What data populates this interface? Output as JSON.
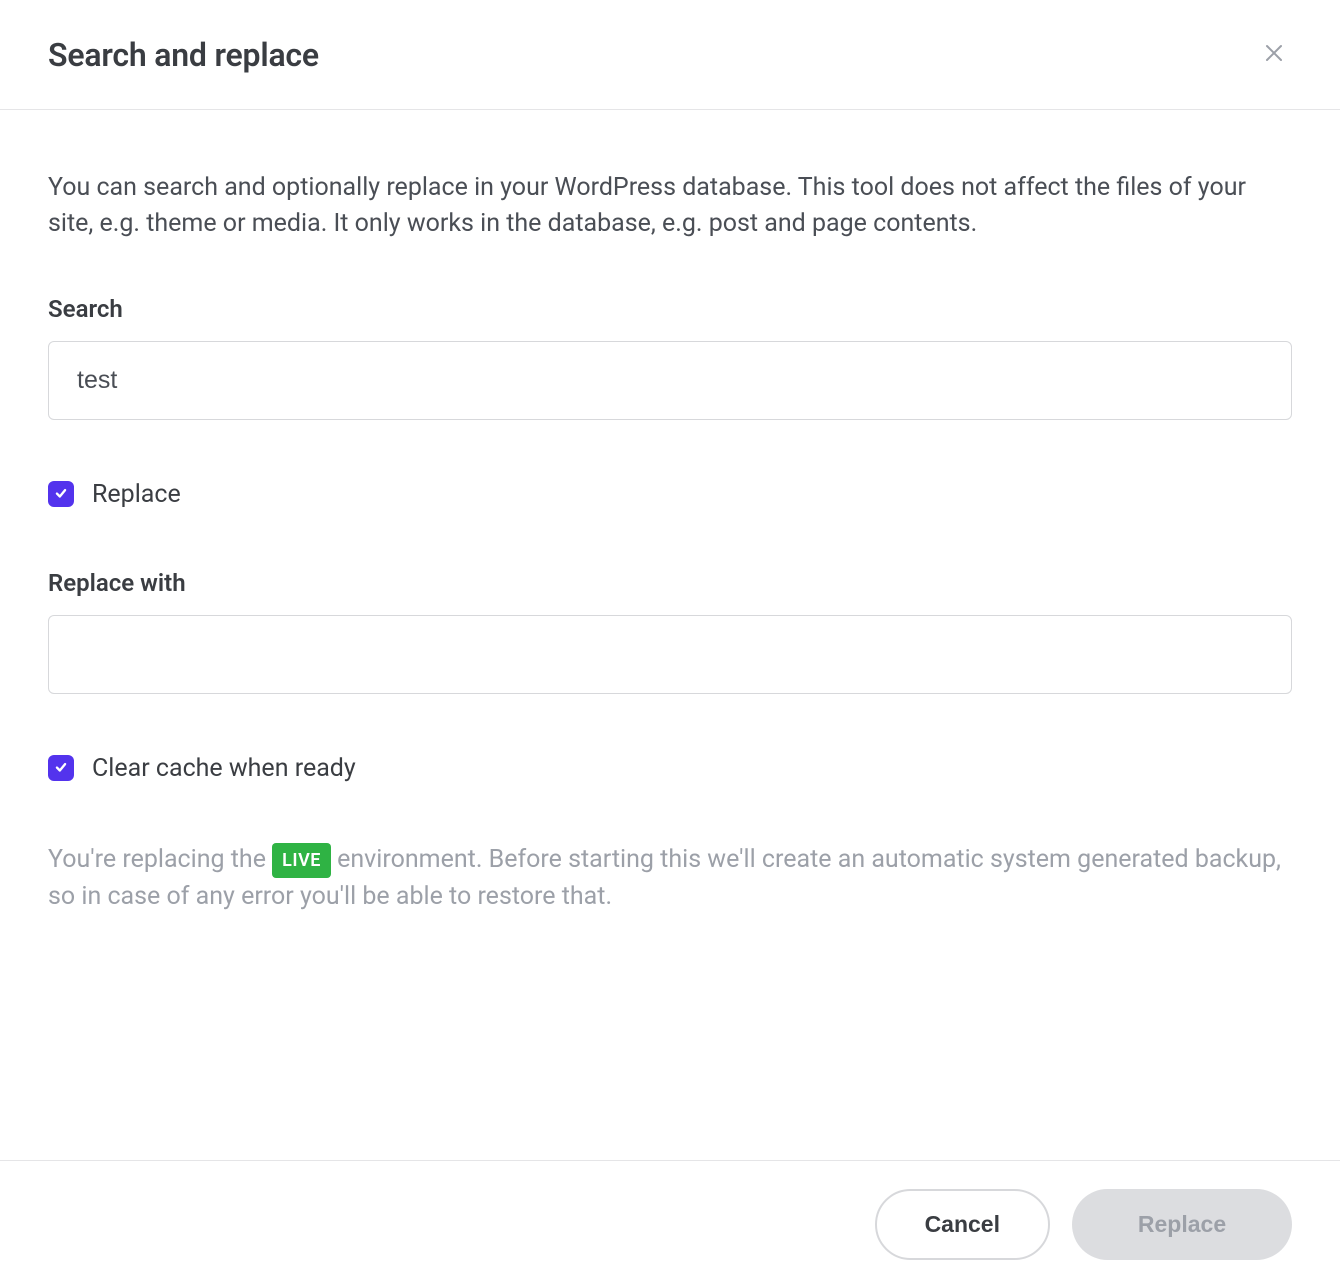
{
  "header": {
    "title": "Search and replace"
  },
  "body": {
    "description": "You can search and optionally replace in your WordPress database. This tool does not affect the files of your site, e.g. theme or media. It only works in the database, e.g. post and page contents.",
    "search": {
      "label": "Search",
      "value": "test"
    },
    "replace_checkbox": {
      "label": "Replace"
    },
    "replace_with": {
      "label": "Replace with",
      "value": ""
    },
    "clear_cache_checkbox": {
      "label": "Clear cache when ready"
    },
    "warning": {
      "pre": "You're replacing the ",
      "badge": "LIVE",
      "post": " environment. Before starting this we'll create an automatic system generated backup, so in case of any error you'll be able to restore that."
    }
  },
  "footer": {
    "cancel_label": "Cancel",
    "replace_label": "Replace"
  }
}
